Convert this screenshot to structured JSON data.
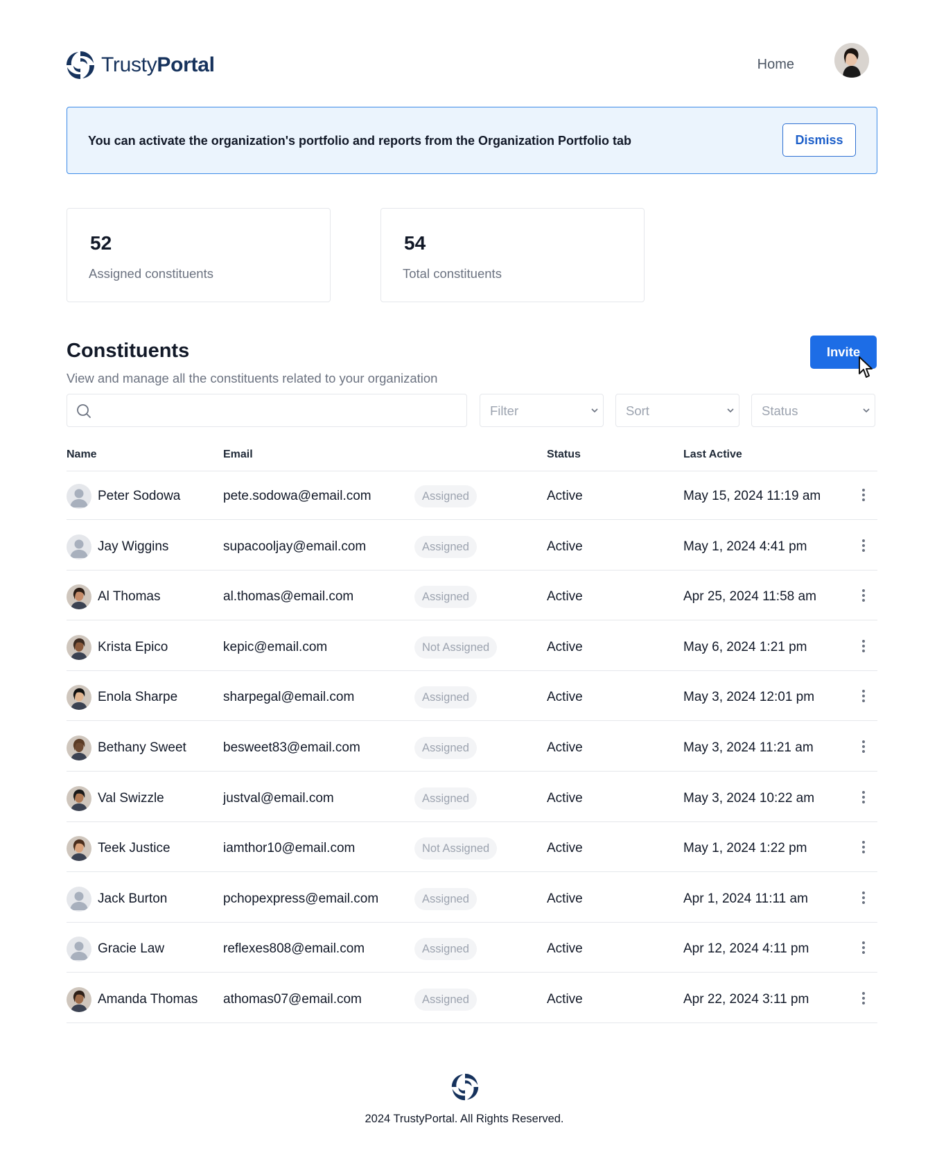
{
  "brand": {
    "name_light": "Trusty",
    "name_bold": "Portal",
    "color": "#16325c"
  },
  "nav": {
    "home_label": "Home"
  },
  "banner": {
    "text": "You can activate the organization's portfolio and reports from the Organization Portfolio tab",
    "dismiss_label": "Dismiss"
  },
  "stats": [
    {
      "value": "52",
      "label": "Assigned constituents"
    },
    {
      "value": "54",
      "label": "Total constituents"
    }
  ],
  "section": {
    "title": "Constituents",
    "subtitle": "View and manage all the constituents related to your organization",
    "invite_label": "Invite"
  },
  "controls": {
    "search_value": "",
    "filter_label": "Filter",
    "sort_label": "Sort",
    "status_label": "Status"
  },
  "table": {
    "headers": {
      "name": "Name",
      "email": "Email",
      "status": "Status",
      "last_active": "Last Active"
    },
    "rows": [
      {
        "name": "Peter Sodowa",
        "email": "pete.sodowa@email.com",
        "assignment": "Assigned",
        "status": "Active",
        "last_active": "May 15, 2024 11:19 am",
        "avatar": "placeholder"
      },
      {
        "name": "Jay Wiggins",
        "email": "supacooljay@email.com",
        "assignment": "Assigned",
        "status": "Active",
        "last_active": "May 1, 2024 4:41 pm",
        "avatar": "placeholder"
      },
      {
        "name": "Al Thomas",
        "email": "al.thomas@email.com",
        "assignment": "Assigned",
        "status": "Active",
        "last_active": "Apr 25, 2024 11:58 am",
        "avatar": "photo"
      },
      {
        "name": "Krista Epico",
        "email": "kepic@email.com",
        "assignment": "Not Assigned",
        "status": "Active",
        "last_active": "May 6, 2024 1:21 pm",
        "avatar": "photo"
      },
      {
        "name": "Enola Sharpe",
        "email": "sharpegal@email.com",
        "assignment": "Assigned",
        "status": "Active",
        "last_active": "May 3, 2024 12:01 pm",
        "avatar": "photo"
      },
      {
        "name": "Bethany Sweet",
        "email": "besweet83@email.com",
        "assignment": "Assigned",
        "status": "Active",
        "last_active": "May 3, 2024 11:21 am",
        "avatar": "photo"
      },
      {
        "name": "Val Swizzle",
        "email": "justval@email.com",
        "assignment": "Assigned",
        "status": "Active",
        "last_active": "May 3, 2024 10:22 am",
        "avatar": "photo"
      },
      {
        "name": "Teek Justice",
        "email": "iamthor10@email.com",
        "assignment": "Not Assigned",
        "status": "Active",
        "last_active": "May 1, 2024 1:22 pm",
        "avatar": "photo"
      },
      {
        "name": "Jack Burton",
        "email": "pchopexpress@email.com",
        "assignment": "Assigned",
        "status": "Active",
        "last_active": "Apr 1, 2024 11:11 am",
        "avatar": "placeholder"
      },
      {
        "name": "Gracie Law",
        "email": "reflexes808@email.com",
        "assignment": "Assigned",
        "status": "Active",
        "last_active": "Apr 12, 2024 4:11 pm",
        "avatar": "placeholder"
      },
      {
        "name": "Amanda Thomas",
        "email": "athomas07@email.com",
        "assignment": "Assigned",
        "status": "Active",
        "last_active": "Apr 22, 2024 3:11 pm",
        "avatar": "photo"
      }
    ]
  },
  "footer": {
    "text": "2024 TrustyPortal. All Rights Reserved."
  },
  "colors": {
    "accent": "#1d6de6",
    "banner_bg": "#ebf4fd",
    "banner_border": "#3b8ae8"
  }
}
